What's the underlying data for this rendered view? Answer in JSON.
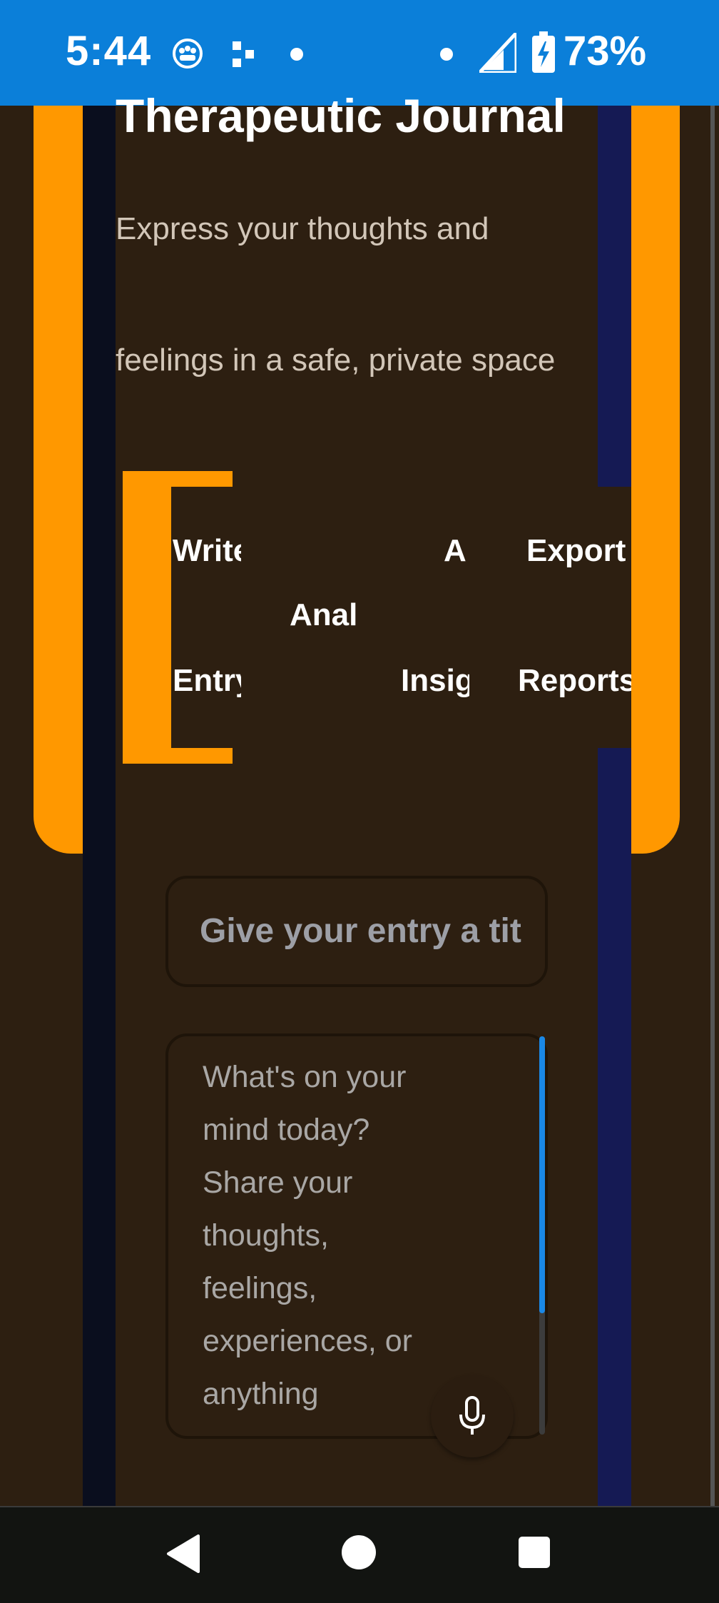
{
  "status_bar": {
    "time": "5:44",
    "battery": "73%",
    "background_color": "#0b7fd9",
    "icons": [
      "privacy-icon",
      "app-notification-icon",
      "dot-icon",
      "dot-icon",
      "signal-icon",
      "battery-charging-icon"
    ]
  },
  "header": {
    "title": "Therapeutic Journal",
    "subtitle_line1": "Express your thoughts and",
    "subtitle_line2": "feelings in a safe, private space"
  },
  "tabs": [
    {
      "line1": "Write",
      "line2": "Entry"
    },
    {
      "line1": "Anal"
    },
    {
      "line1": "AI",
      "line2": "Insig"
    },
    {
      "line1": "Export",
      "line2": "Reports"
    }
  ],
  "form": {
    "title_placeholder": "Give your entry a tit",
    "body_placeholder": "What's on your mind today? Share your thoughts, feelings, experiences, or anything",
    "mic_icon": "microphone-icon"
  },
  "colors": {
    "accent": "#ff9800",
    "background": "#2d1f11",
    "scrollbar": "#1a88e6"
  },
  "nav": {
    "icons": [
      "back-icon",
      "home-icon",
      "recents-icon"
    ]
  }
}
